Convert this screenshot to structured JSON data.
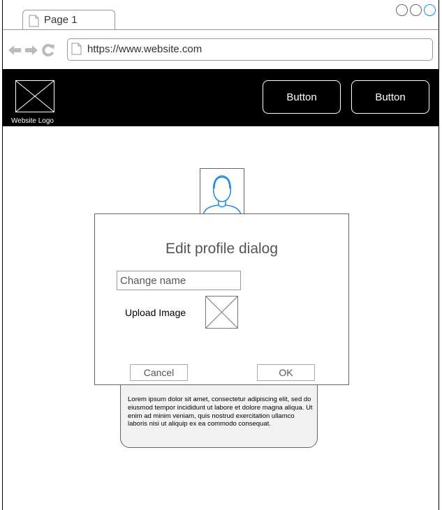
{
  "browser": {
    "tab": {
      "label": "Page 1",
      "icon": "page-icon"
    },
    "url": "https://www.website.com",
    "nav_icons": [
      "back-arrow-icon",
      "forward-arrow-icon",
      "reload-icon"
    ],
    "window_controls": [
      "window-circle-icon",
      "window-circle-icon",
      "window-circle-icon"
    ]
  },
  "header": {
    "logo_label": "Website Logo",
    "buttons": [
      {
        "label": "Button"
      },
      {
        "label": "Button"
      }
    ]
  },
  "profile": {
    "avatar_icon": "user-avatar-icon"
  },
  "dialog": {
    "title": "Edit profile dialog",
    "name_placeholder": "Change name",
    "upload_label": "Upload Image",
    "cancel_label": "Cancel",
    "ok_label": "OK"
  },
  "tooltip": {
    "text": "Lorem ipsum dolor sit amet, consectetur adipiscing elit, sed do eiusmod tempor incididunt ut labore et dolore magna aliqua. Ut enim ad minim veniam, quis nostrud exercitation ullamco laboris nisi ut aliquip ex ea commodo consequat."
  },
  "colors": {
    "header_bg": "#000000",
    "accent_blue": "#1e88e5",
    "border_gray": "#999999"
  }
}
